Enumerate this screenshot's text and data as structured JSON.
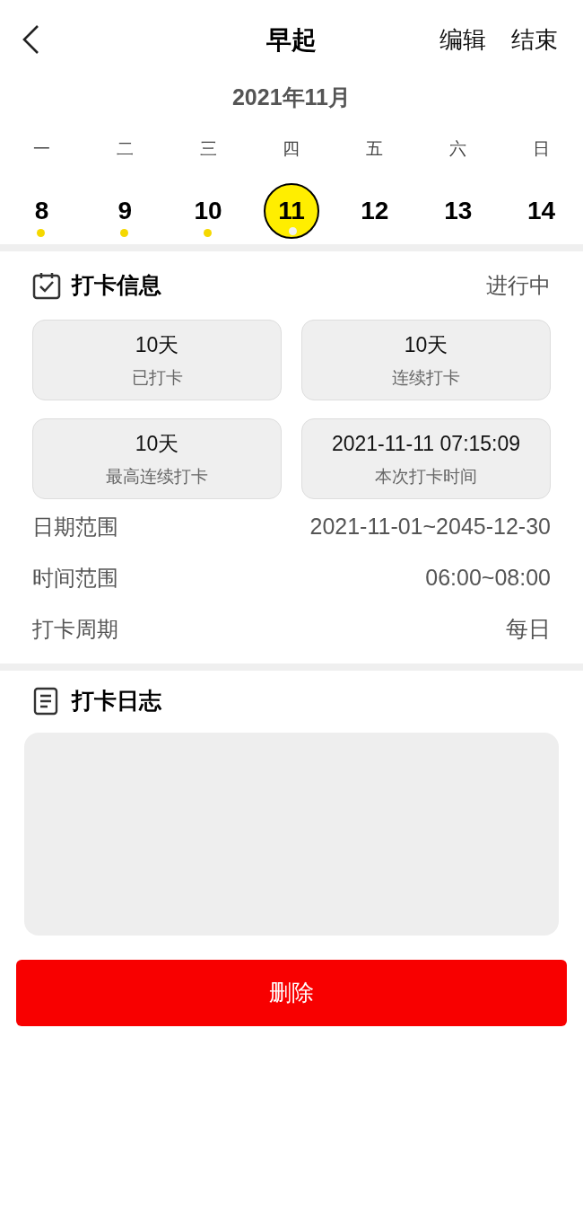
{
  "header": {
    "title": "早起",
    "actions": [
      "编辑",
      "结束"
    ]
  },
  "calendar": {
    "month": "2021年11月",
    "weekdays": [
      "一",
      "二",
      "三",
      "四",
      "五",
      "六",
      "日"
    ],
    "days": [
      {
        "label": "8",
        "selected": false,
        "checked": true
      },
      {
        "label": "9",
        "selected": false,
        "checked": true
      },
      {
        "label": "10",
        "selected": false,
        "checked": true
      },
      {
        "label": "11",
        "selected": true,
        "checked": true
      },
      {
        "label": "12",
        "selected": false,
        "checked": false
      },
      {
        "label": "13",
        "selected": false,
        "checked": false
      },
      {
        "label": "14",
        "selected": false,
        "checked": false
      }
    ]
  },
  "info": {
    "title": "打卡信息",
    "status": "进行中",
    "stats": [
      {
        "value": "10天",
        "label": "已打卡"
      },
      {
        "value": "10天",
        "label": "连续打卡"
      },
      {
        "value": "10天",
        "label": "最高连续打卡"
      },
      {
        "value": "2021-11-11 07:15:09",
        "label": "本次打卡时间"
      }
    ],
    "rows": [
      {
        "label": "日期范围",
        "value": "2021-11-01~2045-12-30"
      },
      {
        "label": "时间范围",
        "value": "06:00~08:00"
      },
      {
        "label": "打卡周期",
        "value": "每日"
      }
    ]
  },
  "log": {
    "title": "打卡日志"
  },
  "delete_button": "删除"
}
